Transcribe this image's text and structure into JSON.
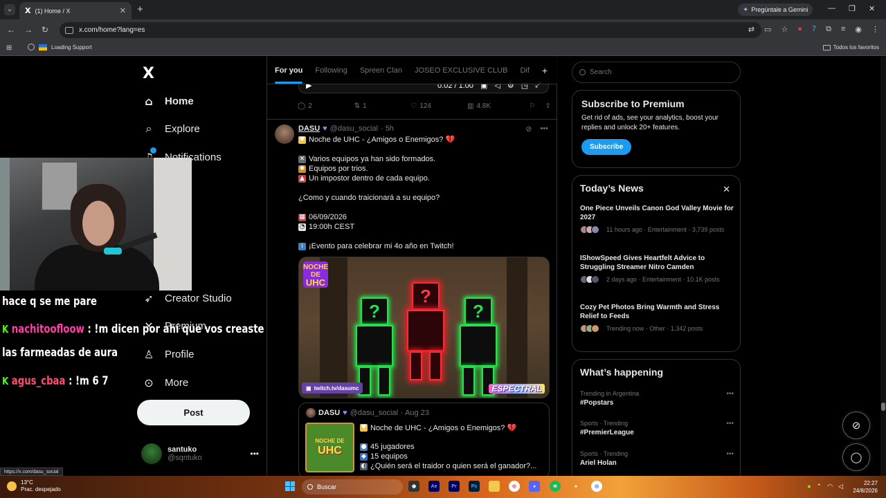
{
  "browser": {
    "tab_title": "(1) Home / X",
    "tab_logo": "X",
    "new_tab": "+",
    "gemini_label": "Pregúntale a Gemini",
    "url": "x.com/home?lang=es",
    "bookmark_item": "Loading Support",
    "bookmarks_all": "Todos los favoritos",
    "status_url": "https://x.com/dasu_social"
  },
  "nav": {
    "logo": "X",
    "items": [
      {
        "label": "Home",
        "icon": "home-icon"
      },
      {
        "label": "Explore",
        "icon": "search-icon"
      },
      {
        "label": "Notifications",
        "icon": "bell-icon"
      },
      {
        "label": "Creator Studio",
        "icon": "rocket-icon"
      },
      {
        "label": "Premium",
        "icon": "x-premium-icon"
      },
      {
        "label": "Profile",
        "icon": "person-icon"
      },
      {
        "label": "More",
        "icon": "more-circle-icon"
      }
    ],
    "post_button": "Post",
    "account": {
      "name": "santuko",
      "handle": "@sqntuko",
      "menu": "•••"
    }
  },
  "stream_chat": [
    {
      "prefix": "",
      "user": "",
      "text": "hace q se me pare"
    },
    {
      "prefix": "K",
      "user": "nachitoofloow",
      "text": " : !m dicen por ahí que vos creaste"
    },
    {
      "prefix": "",
      "user": "",
      "text": "las farmeadas de aura"
    },
    {
      "prefix": "K",
      "user": "agus_cbaa",
      "text": " : !m 6 7"
    }
  ],
  "timeline": {
    "tabs": [
      "For you",
      "Following",
      "Spreen Clan",
      "JOSEO EXCLUSIVE CLUB",
      "Dif"
    ],
    "add_tab": "+",
    "prev_post": {
      "video_time": "0:02 / 1:00",
      "replies": "2",
      "reposts": "1",
      "likes": "124",
      "views": "4.8K"
    },
    "post": {
      "name": "DASU",
      "handle": "@dasu_social",
      "time": "· 5h",
      "lines": [
        {
          "emoji": "yellow-heart-emoji",
          "text": "Noche de UHC - ¿Amigos o Enemigos? 💔"
        },
        {
          "emoji": "",
          "text": ""
        },
        {
          "emoji": "crossed-swords-emoji",
          "text": "Varios equipos ya han sido formados."
        },
        {
          "emoji": "sparkle-emoji",
          "text": "Equipos por trios."
        },
        {
          "emoji": "siren-emoji",
          "text": "Un impostor dentro de cada equipo."
        },
        {
          "emoji": "",
          "text": ""
        },
        {
          "emoji": "",
          "text": "¿Como y cuando traicionará a su equipo?"
        },
        {
          "emoji": "",
          "text": ""
        },
        {
          "emoji": "calendar-emoji",
          "text": "06/09/2026"
        },
        {
          "emoji": "clock-emoji",
          "text": "19:00h CEST"
        },
        {
          "emoji": "",
          "text": ""
        },
        {
          "emoji": "info-emoji",
          "text": "¡Evento para celebrar mi 4o año en Twitch!"
        }
      ],
      "media": {
        "badge_top": "NOCHE DE",
        "badge_big": "UHC",
        "twitch_tag": "twitch.tv/dasumc",
        "brand_tag": "ESPECTRAL"
      },
      "quote": {
        "name": "DASU",
        "handle": "@dasu_social",
        "time": "· Aug 23",
        "title": "Noche de UHC - ¿Amigos o Enemigos? 💔",
        "thumb_top": "NOCHE DE",
        "thumb_big": "UHC",
        "lines": [
          "45 jugadores",
          "15 equipos",
          "¿Quién será el traidor o quien será el ganador?..."
        ]
      }
    }
  },
  "sidebar": {
    "search_placeholder": "Search",
    "premium": {
      "title": "Subscribe to Premium",
      "text": "Get rid of ads, see your analytics, boost your replies and unlock 20+ features.",
      "button": "Subscribe"
    },
    "news": {
      "title": "Today’s News",
      "items": [
        {
          "title": "One Piece Unveils Canon God Valley Movie for 2027",
          "meta": "11 hours ago · Entertainment · 3,739 posts"
        },
        {
          "title": "IShowSpeed Gives Heartfelt Advice to Struggling Streamer Nitro Camden",
          "meta": "2 days ago · Entertainment · 10.1K posts"
        },
        {
          "title": "Cozy Pet Photos Bring Warmth and Stress Relief to Feeds",
          "meta": "Trending now · Other · 1,342 posts"
        }
      ]
    },
    "happening": {
      "title": "What’s happening",
      "trends": [
        {
          "context": "Trending in Argentina",
          "name": "#Popstars"
        },
        {
          "context": "Sports · Trending",
          "name": "#PremierLeague"
        },
        {
          "context": "Sports · Trending",
          "name": "Ariel Holan"
        }
      ]
    }
  },
  "taskbar": {
    "temp": "13°C",
    "weather": "Prac. despejado",
    "search": "Buscar",
    "time": "22:27",
    "date": "24/8/2026"
  },
  "colors": {
    "accent": "#1d9bf0",
    "background": "#000000",
    "muted": "#71767b",
    "kick_green": "#53fc18"
  }
}
